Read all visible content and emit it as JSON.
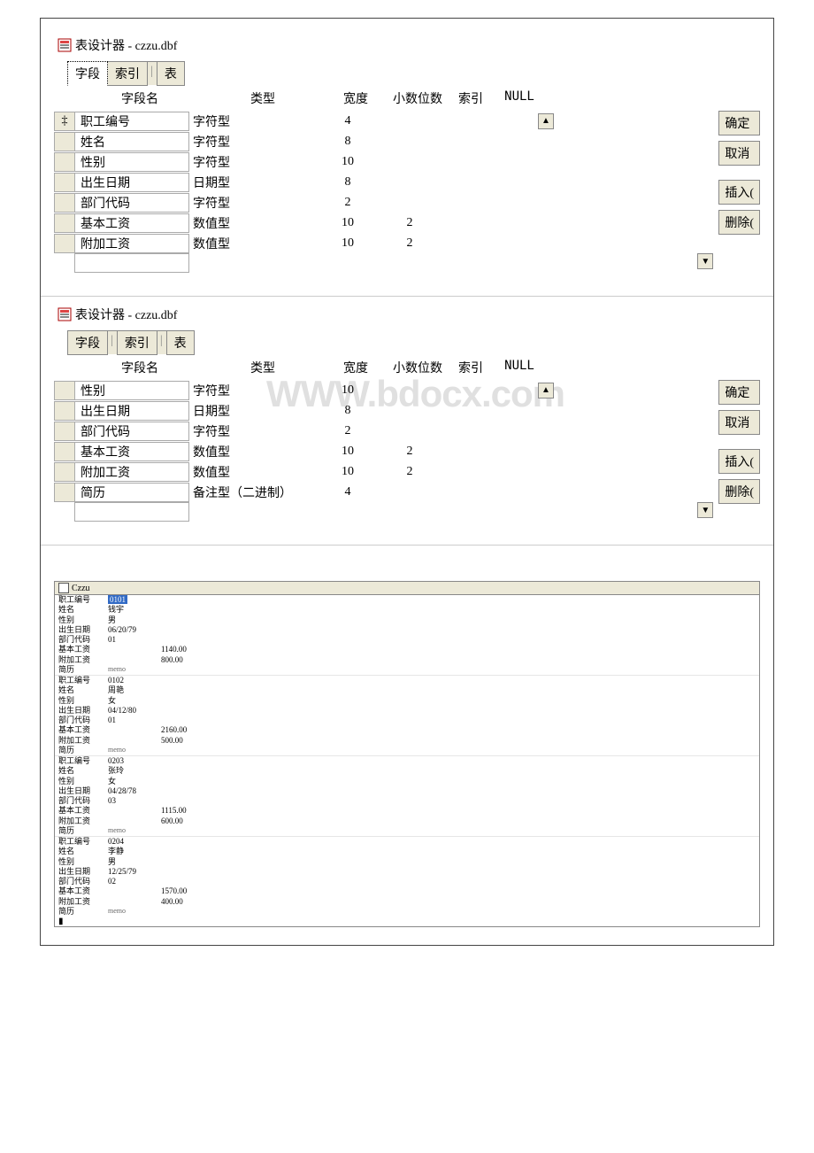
{
  "window_title": "表设计器 - czzu.dbf",
  "tabs": {
    "fields": "字段",
    "index": "索引",
    "table": "表"
  },
  "headers": {
    "name": "字段名",
    "type": "类型",
    "width": "宽度",
    "decimal": "小数位数",
    "index": "索引",
    "null": "NULL"
  },
  "buttons": {
    "ok": "确定",
    "cancel": "取消",
    "insert": "插入(",
    "delete": "删除("
  },
  "designer1_rows": [
    {
      "name": "职工编号",
      "type": "字符型",
      "width": "4",
      "decimal": ""
    },
    {
      "name": "姓名",
      "type": "字符型",
      "width": "8",
      "decimal": ""
    },
    {
      "name": "性别",
      "type": "字符型",
      "width": "10",
      "decimal": ""
    },
    {
      "name": "出生日期",
      "type": "日期型",
      "width": "8",
      "decimal": ""
    },
    {
      "name": "部门代码",
      "type": "字符型",
      "width": "2",
      "decimal": ""
    },
    {
      "name": "基本工资",
      "type": "数值型",
      "width": "10",
      "decimal": "2"
    },
    {
      "name": "附加工资",
      "type": "数值型",
      "width": "10",
      "decimal": "2"
    }
  ],
  "designer2_rows": [
    {
      "name": "性别",
      "type": "字符型",
      "width": "10",
      "decimal": ""
    },
    {
      "name": "出生日期",
      "type": "日期型",
      "width": "8",
      "decimal": ""
    },
    {
      "name": "部门代码",
      "type": "字符型",
      "width": "2",
      "decimal": ""
    },
    {
      "name": "基本工资",
      "type": "数值型",
      "width": "10",
      "decimal": "2"
    },
    {
      "name": "附加工资",
      "type": "数值型",
      "width": "10",
      "decimal": "2"
    },
    {
      "name": "简历",
      "type": "备注型（二进制）",
      "width": "4",
      "decimal": ""
    }
  ],
  "records_title": "Czzu",
  "record_labels": {
    "emp_no": "职工编号",
    "name": "姓名",
    "sex": "性别",
    "birth": "出生日期",
    "dept": "部门代码",
    "base": "基本工资",
    "extra": "附加工资",
    "resume": "简历"
  },
  "records": [
    {
      "emp_no": "0101",
      "name": "钱宇",
      "sex": "男",
      "birth": "06/20/79",
      "dept": "01",
      "base": "1140.00",
      "extra": "800.00",
      "resume": "memo"
    },
    {
      "emp_no": "0102",
      "name": "周艳",
      "sex": "女",
      "birth": "04/12/80",
      "dept": "01",
      "base": "2160.00",
      "extra": "500.00",
      "resume": "memo"
    },
    {
      "emp_no": "0203",
      "name": "张玲",
      "sex": "女",
      "birth": "04/28/78",
      "dept": "03",
      "base": "1115.00",
      "extra": "600.00",
      "resume": "memo"
    },
    {
      "emp_no": "0204",
      "name": "李静",
      "sex": "男",
      "birth": "12/25/79",
      "dept": "02",
      "base": "1570.00",
      "extra": "400.00",
      "resume": "memo"
    }
  ],
  "watermark": "WWW.bdocx.com"
}
